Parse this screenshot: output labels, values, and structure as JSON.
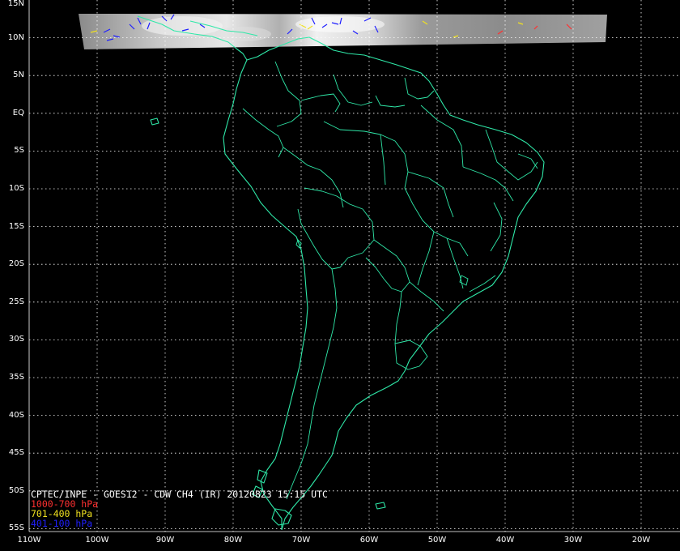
{
  "title": "CPTEC/INPE - GOES12 - CDW CH4 (IR) 20120823 15:15 UTC",
  "legend": [
    {
      "label": "1000-700 hPa",
      "color": "#ff3030"
    },
    {
      "label": "701-400 hPa",
      "color": "#f0e020"
    },
    {
      "label": "401-100 hPa",
      "color": "#2020ff"
    }
  ],
  "colors": {
    "coast": "#2fe8a8",
    "grid": "#ffffff",
    "background": "#000000"
  },
  "lat_labels": [
    "15N",
    "10N",
    "5N",
    "EQ",
    "5S",
    "10S",
    "15S",
    "20S",
    "25S",
    "30S",
    "35S",
    "40S",
    "45S",
    "50S",
    "55S"
  ],
  "lon_labels": [
    "110W",
    "100W",
    "90W",
    "80W",
    "70W",
    "60W",
    "50W",
    "40W",
    "30W",
    "20W"
  ]
}
